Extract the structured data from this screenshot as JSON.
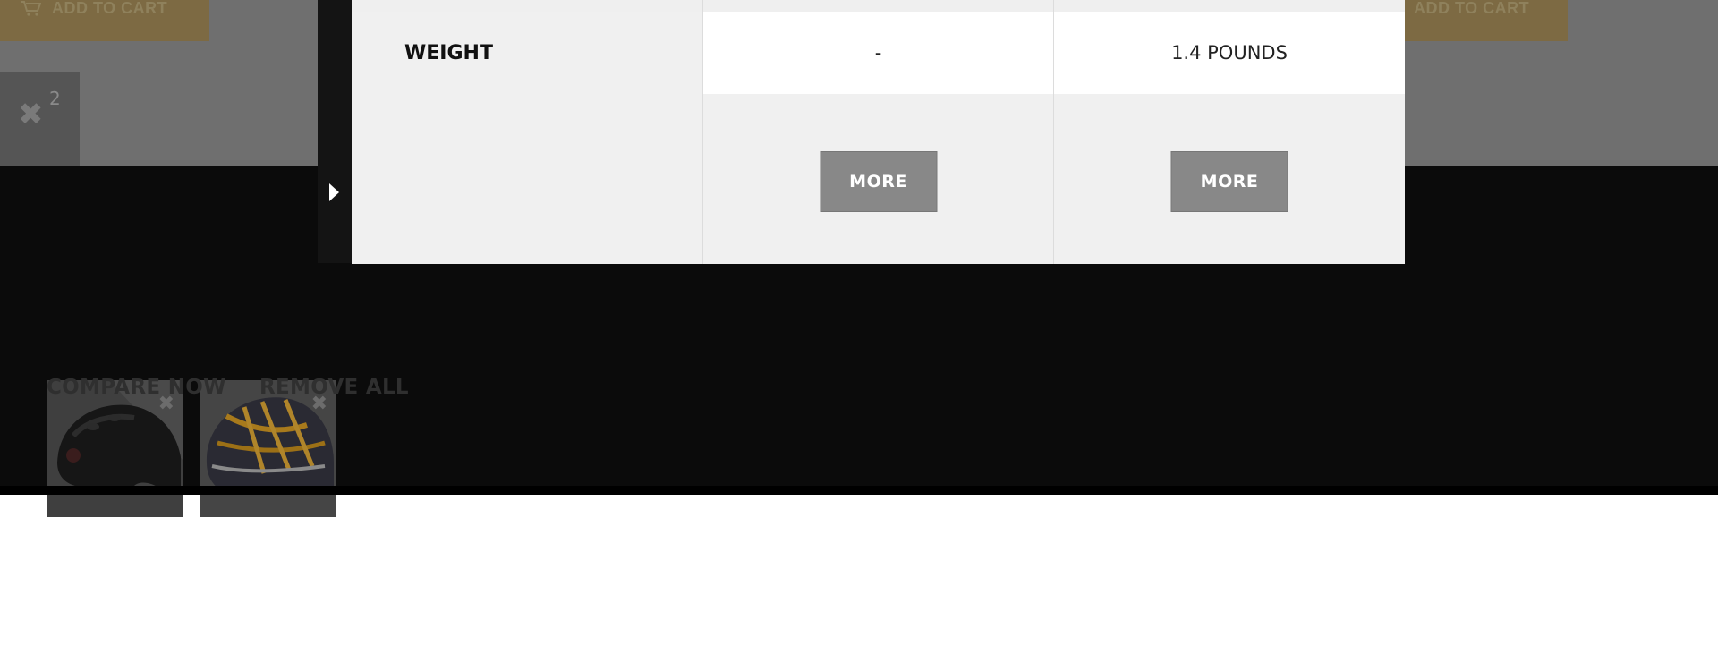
{
  "background": {
    "cart_label": "ADD TO CART",
    "remove_count": "2",
    "footer_links": {
      "compare": "COMPARE NOW",
      "remove_all": "REMOVE ALL"
    }
  },
  "compare_table": {
    "row_label": "WEIGHT",
    "products": [
      {
        "weight": "-",
        "more_label": "MORE"
      },
      {
        "weight": "1.4 POUNDS",
        "more_label": "MORE"
      }
    ]
  },
  "colors": {
    "accent_dimmed": "#7d6a43",
    "button_gray": "#888888",
    "footer_bg": "#0b0b0b"
  }
}
